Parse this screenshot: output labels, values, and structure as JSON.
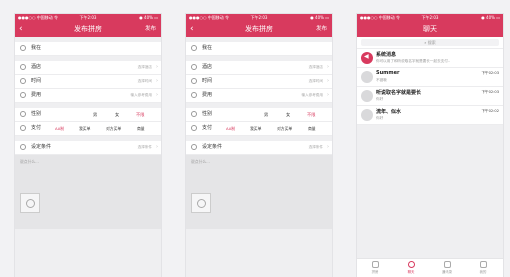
{
  "status": {
    "carrier": "●●●○○ 中国移动 令",
    "time": "下午2:03",
    "battery": "● 40% ▭"
  },
  "publish": {
    "title": "发布拼房",
    "action": "发布",
    "rows": [
      {
        "label": "我在",
        "value": ""
      },
      {
        "label": "酒店",
        "value": "选择酒店"
      },
      {
        "label": "时间",
        "value": "选择时间"
      },
      {
        "label": "费用",
        "value": "输入参考费用"
      }
    ],
    "gender": {
      "label": "性别",
      "options": [
        "男",
        "女",
        "不限"
      ]
    },
    "pay": {
      "label": "支付",
      "options": [
        "AA制",
        "我买单",
        "对方买单",
        "商量"
      ]
    },
    "conditions": {
      "label": "设定条件",
      "value": "选择条件"
    },
    "placeholder": "说点什么..."
  },
  "chat": {
    "title": "聊天",
    "search": "搜索",
    "items": [
      {
        "name": "系统消息",
        "msg": "你可以用了和听说取名字就是要长一起去支付..",
        "time": ""
      },
      {
        "name": "Summer",
        "msg": "不错哦",
        "time": "下午02:03"
      },
      {
        "name": "听说取名字就是要长",
        "msg": "你好",
        "time": "下午02:03"
      },
      {
        "name": "流年、似水",
        "msg": "你好",
        "time": "下午02:02"
      }
    ],
    "tabs": [
      "拼房",
      "聊天",
      "通讯录",
      "我的"
    ]
  }
}
